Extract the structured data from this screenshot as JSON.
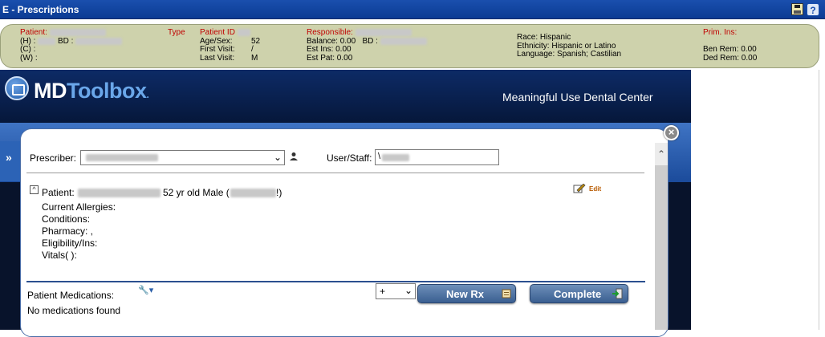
{
  "window": {
    "title": "E - Prescriptions",
    "icons": [
      "save-icon",
      "help-icon"
    ]
  },
  "banner": {
    "patient_label": "Patient:",
    "home_label": "(H) :",
    "bd_label": "BD :",
    "cell_label": "(C) :",
    "work_label": "(W) :",
    "type_label": "Type",
    "patient_id_label": "Patient ID",
    "age_sex_label": "Age/Sex:",
    "age_sex_value": "52 / M",
    "first_visit_label": "First Visit:",
    "last_visit_label": "Last Visit:",
    "responsible_label": "Responsible:",
    "balance": "Balance: 0.00",
    "resp_bd_label": "BD :",
    "est_ins": "Est Ins:  0.00",
    "est_pat": "Est Pat: 0.00",
    "race": "Race: Hispanic",
    "ethnicity": "Ethnicity: Hispanic or Latino",
    "language": "Language: Spanish; Castilian",
    "prim_ins_label": "Prim. Ins:",
    "ben_rem": "Ben Rem: 0.00",
    "ded_rem": "Ded Rem: 0.00"
  },
  "header": {
    "logo_md": "MD",
    "logo_toolbox": "Toolbox",
    "logo_dot": ".",
    "center_name": "Meaningful Use Dental Center",
    "sidebar_toggle": "»"
  },
  "panel": {
    "prescriber_label": "Prescriber:",
    "user_staff_label": "User/Staff:",
    "user_staff_prefix": "\\",
    "collapse_icon": "^",
    "patient_label": "Patient:",
    "patient_suffix": "52 yr old Male (",
    "patient_close": "!)",
    "edit_label": "Edit",
    "current_allergies": "Current Allergies:",
    "conditions": "Conditions:",
    "pharmacy": "Pharmacy: ,",
    "eligibility": "Eligibility/Ins:",
    "vitals": "Vitals( ):",
    "medications_label": "Patient Medications:",
    "no_medications": "No medications found",
    "add_select_value": "+",
    "new_rx_label": "New Rx",
    "complete_label": "Complete",
    "close_symbol": "×"
  },
  "colors": {
    "title_bar": "#0b3b93",
    "banner_bg": "#ced2ac",
    "banner_red": "#c00000",
    "dark_header": "#06173a",
    "blue_band": "#3f74c4",
    "logo_accent": "#6aa7ea",
    "button_blue": "#3a5f91",
    "edit_orange": "#b85a00"
  }
}
